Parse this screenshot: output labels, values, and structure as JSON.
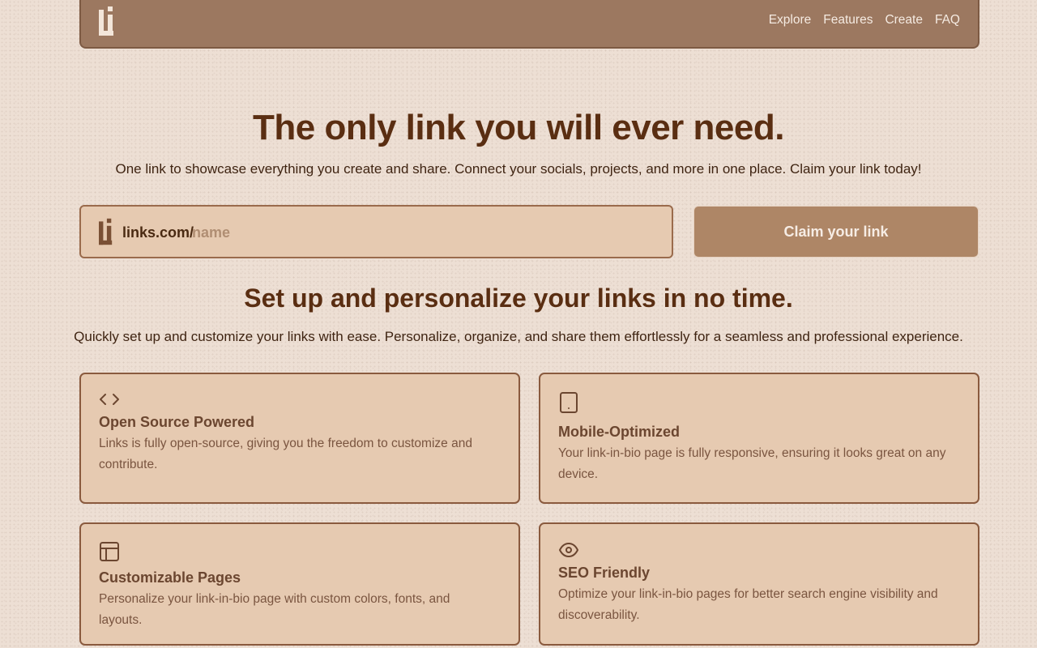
{
  "nav": {
    "logo_icon": "links-logo-icon",
    "links": [
      "Explore",
      "Features",
      "Create",
      "FAQ"
    ]
  },
  "hero": {
    "title": "The only link you will ever need.",
    "subtitle": "One link to showcase everything you create and share. Connect your socials, projects, and more in one place. Claim your link today!"
  },
  "claim": {
    "prefix": "links.com/",
    "placeholder": "name",
    "value": "",
    "button_label": "Claim your link"
  },
  "features_section": {
    "title": "Set up and personalize your links in no time.",
    "subtitle": "Quickly set up and customize your links with ease. Personalize, organize, and share them effortlessly for a seamless and professional experience.",
    "cards": [
      {
        "icon": "code-icon",
        "title": "Open Source Powered",
        "description": "Links is fully open-source, giving you the freedom to customize and contribute."
      },
      {
        "icon": "tablet-icon",
        "title": "Mobile-Optimized",
        "description": "Your link-in-bio page is fully responsive, ensuring it looks great on any device."
      },
      {
        "icon": "layout-icon",
        "title": "Customizable Pages",
        "description": "Personalize your link-in-bio page with custom colors, fonts, and layouts."
      },
      {
        "icon": "eye-icon",
        "title": "SEO Friendly",
        "description": "Optimize your link-in-bio pages for better search engine visibility and discoverability."
      }
    ]
  },
  "colors": {
    "background": "#eddfd4",
    "navbar": "#9c7860",
    "card": "#e6cab1",
    "button": "#ae8666",
    "heading": "#5a2e12"
  }
}
